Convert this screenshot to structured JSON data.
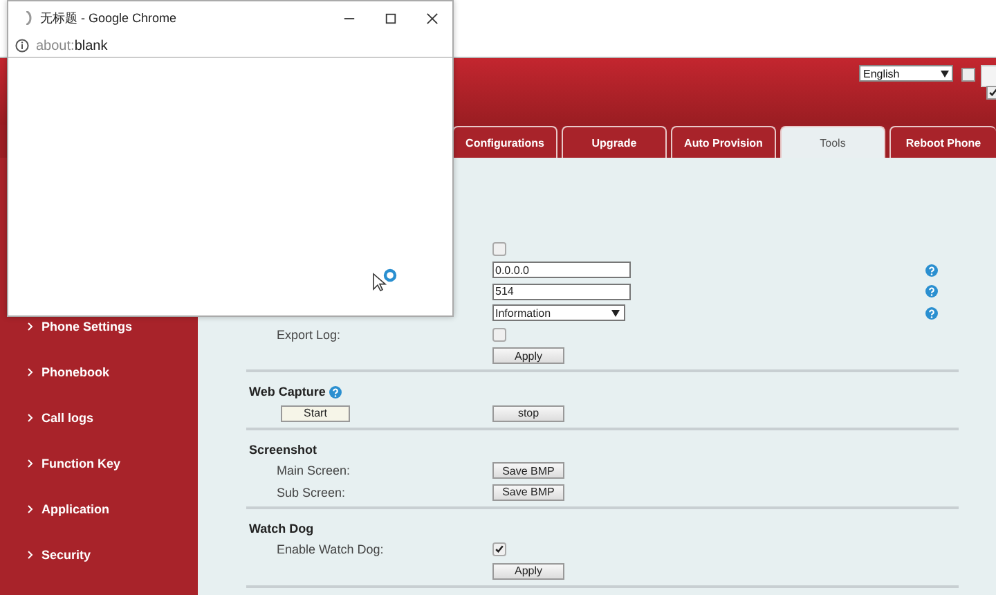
{
  "popup": {
    "title": "无标题 - Google Chrome",
    "address_dim": "about:",
    "address": "blank"
  },
  "header": {
    "language": "English",
    "checkbox": {
      "checked": false
    },
    "remember": {
      "checked": true
    }
  },
  "tabs": [
    {
      "label": "Configurations",
      "selected": false
    },
    {
      "label": "Upgrade",
      "selected": false
    },
    {
      "label": "Auto Provision",
      "selected": false
    },
    {
      "label": "Tools",
      "selected": true
    },
    {
      "label": "Reboot Phone",
      "selected": false
    }
  ],
  "sidebar": {
    "items": [
      "Phone Settings",
      "Phonebook",
      "Call logs",
      "Function Key",
      "Application",
      "Security"
    ]
  },
  "sections": [
    {
      "rows": [
        {
          "kind": "checkbox",
          "checked": false
        },
        {
          "kind": "input",
          "value": "0.0.0.0",
          "help": true
        },
        {
          "kind": "input",
          "value": "514",
          "help": true
        },
        {
          "kind": "select",
          "value": "Information",
          "help": true
        },
        {
          "kind": "checkbox",
          "label": "Export Log:",
          "checked": false
        },
        {
          "kind": "button",
          "button": "Apply"
        }
      ]
    },
    {
      "title": "Web Capture",
      "help": true,
      "rows": [
        {
          "kind": "buttons",
          "left": "Start",
          "button": "stop"
        }
      ]
    },
    {
      "title": "Screenshot",
      "rows": [
        {
          "kind": "button",
          "label": "Main Screen:",
          "button": "Save BMP"
        },
        {
          "kind": "button",
          "label": "Sub Screen:",
          "button": "Save BMP"
        }
      ]
    },
    {
      "title": "Watch Dog",
      "rows": [
        {
          "kind": "checkbox",
          "label": "Enable Watch Dog:",
          "checked": true
        },
        {
          "kind": "button",
          "button": "Apply"
        }
      ]
    }
  ]
}
